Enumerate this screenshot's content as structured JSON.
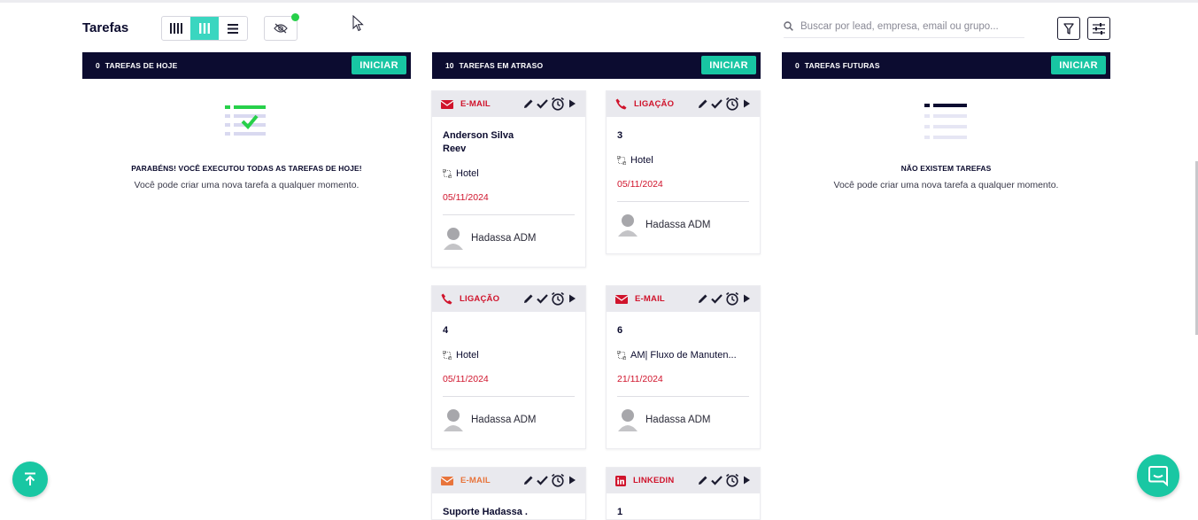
{
  "header": {
    "title": "Tarefas",
    "search_placeholder": "Buscar por lead, empresa, email ou grupo..."
  },
  "view_modes": [
    {
      "icon": "columns-icon",
      "active": false
    },
    {
      "icon": "kanban-icon",
      "active": true
    },
    {
      "icon": "list-icon",
      "active": false
    }
  ],
  "columns": [
    {
      "count": "0",
      "label": "TAREFAS DE HOJE",
      "start_label": "INICIAR",
      "empty_title": "PARABÉNS! VOCÊ EXECUTOU TODAS AS TAREFAS DE HOJE!",
      "empty_text": "Você pode criar uma nova tarefa a qualquer momento."
    },
    {
      "count": "10",
      "label": "TAREFAS EM ATRASO",
      "start_label": "INICIAR"
    },
    {
      "count": "0",
      "label": "TAREFAS FUTURAS",
      "start_label": "INICIAR",
      "empty_title": "NÃO EXISTEM TAREFAS",
      "empty_text": "Você pode criar uma nova tarefa a qualquer momento."
    }
  ],
  "cards": [
    {
      "type": "E-MAIL",
      "type_icon": "email-icon",
      "type_color": "#d0142c",
      "name": "Anderson Silva",
      "company": "Reev",
      "flow": "Hotel",
      "date": "05/11/2024",
      "owner": "Hadassa ADM"
    },
    {
      "type": "LIGAÇÃO",
      "type_icon": "phone-icon",
      "type_color": "#d0142c",
      "name": "3",
      "flow": "Hotel",
      "date": "05/11/2024",
      "owner": "Hadassa ADM"
    },
    {
      "type": "LIGAÇÃO",
      "type_icon": "phone-icon",
      "type_color": "#d0142c",
      "name": "4",
      "flow": "Hotel",
      "date": "05/11/2024",
      "owner": "Hadassa ADM"
    },
    {
      "type": "E-MAIL",
      "type_icon": "email-icon",
      "type_color": "#d0142c",
      "name": "6",
      "flow": "AM| Fluxo de Manuten...",
      "date": "21/11/2024",
      "owner": "Hadassa ADM"
    },
    {
      "type": "E-MAIL",
      "type_icon": "email-icon",
      "type_color": "#e8743b",
      "name": "Suporte Hadassa ."
    },
    {
      "type": "LINKEDIN",
      "type_icon": "linkedin-icon",
      "type_color": "#d0142c",
      "name": "1"
    }
  ]
}
